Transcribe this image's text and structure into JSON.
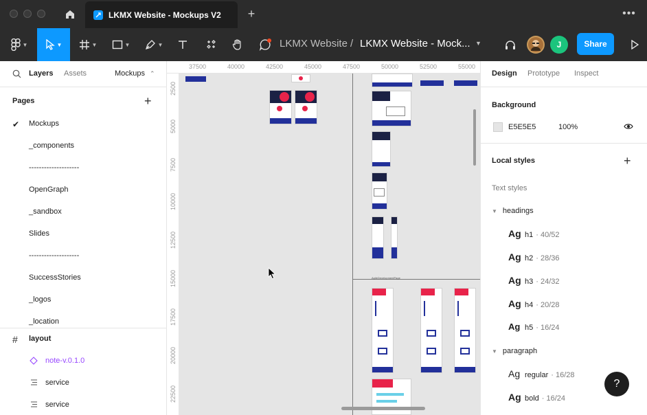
{
  "titlebar": {
    "tab_title": "LKMX Website - Mockups V2",
    "new_tab_label": "+",
    "more_label": "•••"
  },
  "toolbar": {
    "breadcrumb_project": "LKMX Website",
    "breadcrumb_separator": "/",
    "breadcrumb_file": "LKMX Website - Mock...",
    "avatar_initial": "J",
    "share_label": "Share"
  },
  "left_panel": {
    "tabs": [
      "Layers",
      "Assets"
    ],
    "page_selector": "Mockups",
    "pages_title": "Pages",
    "pages": [
      "Mockups",
      "_components",
      "--------------------",
      "OpenGraph",
      "_sandbox",
      "Slides",
      "--------------------",
      "SuccessStories",
      "_logos",
      "_location"
    ],
    "current_page": "Mockups",
    "layers": [
      {
        "label": "layout",
        "icon": "frame-icon"
      },
      {
        "label": "note-v.0.1.0",
        "icon": "component-instance-icon"
      },
      {
        "label": "service",
        "icon": "auto-layout-icon"
      },
      {
        "label": "service",
        "icon": "auto-layout-icon"
      }
    ]
  },
  "canvas": {
    "ruler_x": [
      "37500",
      "40000",
      "42500",
      "45000",
      "47500",
      "50000",
      "52500",
      "55000"
    ],
    "ruler_y": [
      "2500",
      "5000",
      "7500",
      "10000",
      "12500",
      "15000",
      "17500",
      "20000",
      "22500"
    ],
    "section_label": "AgileDevelopmentPage"
  },
  "right_panel": {
    "tabs": [
      "Design",
      "Prototype",
      "Inspect"
    ],
    "background_title": "Background",
    "background_hex": "E5E5E5",
    "background_opacity": "100%",
    "local_styles_title": "Local styles",
    "text_styles_title": "Text styles",
    "groups": [
      {
        "name": "headings",
        "styles": [
          {
            "sample": "Ag",
            "name": "h1",
            "meta": "· 40/52"
          },
          {
            "sample": "Ag",
            "name": "h2",
            "meta": "· 28/36"
          },
          {
            "sample": "Ag",
            "name": "h3",
            "meta": "· 24/32"
          },
          {
            "sample": "Ag",
            "name": "h4",
            "meta": "· 20/28"
          },
          {
            "sample": "Ag",
            "name": "h5",
            "meta": "· 16/24"
          }
        ]
      },
      {
        "name": "paragraph",
        "styles": [
          {
            "sample": "Ag",
            "name": "regular",
            "meta": "· 16/28"
          },
          {
            "sample": "Ag",
            "name": "bold",
            "meta": "· 16/24"
          }
        ]
      }
    ],
    "help_label": "?"
  },
  "colors": {
    "accent": "#0d99ff",
    "chrome": "#2c2c2c",
    "canvas_bg": "#e5e5e5",
    "frame_navy": "#22309a",
    "component_purple": "#9747ff"
  }
}
